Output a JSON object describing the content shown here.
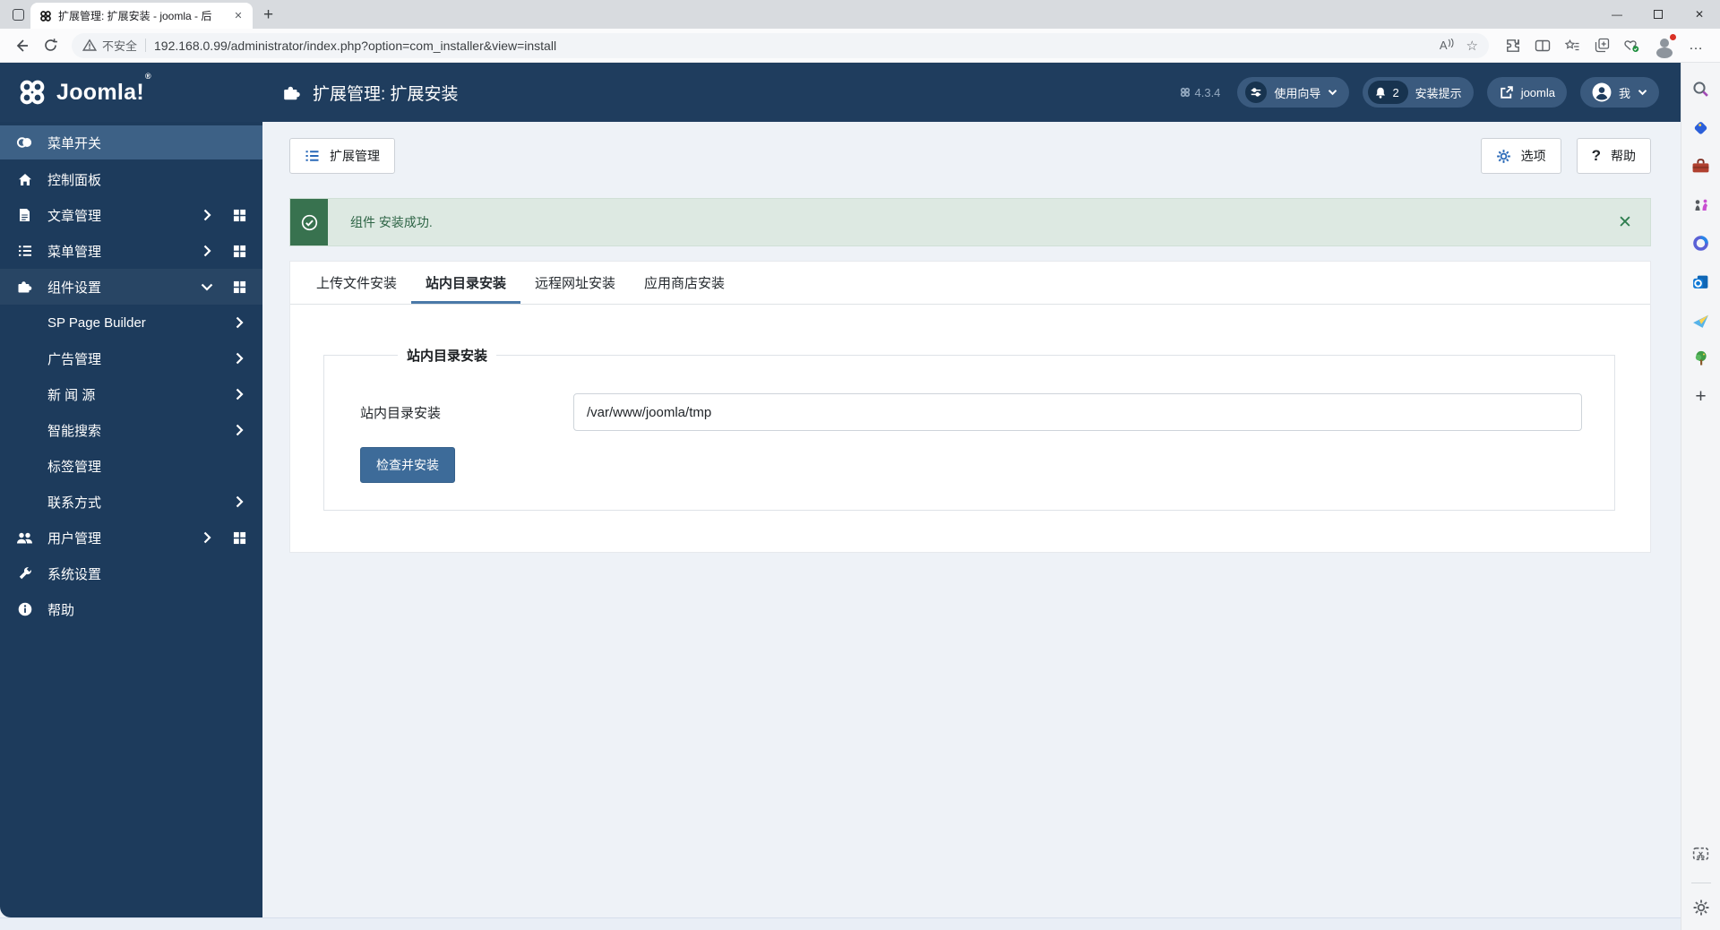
{
  "browser": {
    "tab_title": "扩展管理: 扩展安装 - joomla - 后",
    "new_tab_glyph": "+",
    "security_label": "不安全",
    "url": "192.168.0.99/administrator/index.php?option=com_installer&view=install"
  },
  "glyphs": {
    "close": "✕",
    "minimize": "—",
    "more": "…",
    "read_aloud": "A",
    "star": "☆",
    "plus": "+",
    "question": "?"
  },
  "header": {
    "logo_text": "Joomla!",
    "logo_reg": "®",
    "page_title": "扩展管理: 扩展安装",
    "version": "4.3.4",
    "guide_pill": "使用向导",
    "notice_count": "2",
    "notice_pill": "安装提示",
    "site_pill": "joomla",
    "me_pill": "我"
  },
  "sidebar": {
    "items": [
      {
        "label": "菜单开关",
        "icon": "toggle-icon",
        "active": true
      },
      {
        "label": "控制面板",
        "icon": "home-icon"
      },
      {
        "label": "文章管理",
        "icon": "article-icon",
        "chevron": "right",
        "grid": true
      },
      {
        "label": "菜单管理",
        "icon": "menus-icon",
        "chevron": "right",
        "grid": true
      },
      {
        "label": "组件设置",
        "icon": "components-icon",
        "chevron": "down",
        "grid": true,
        "expanded": true
      },
      {
        "label": "用户管理",
        "icon": "users-icon",
        "chevron": "right",
        "grid": true
      },
      {
        "label": "系统设置",
        "icon": "system-icon"
      },
      {
        "label": "帮助",
        "icon": "help-icon"
      }
    ],
    "sub_items": [
      {
        "label": "SP Page Builder",
        "chevron": "right"
      },
      {
        "label": "广告管理",
        "chevron": "right"
      },
      {
        "label": "新 闻 源",
        "chevron": "right"
      },
      {
        "label": "智能搜索",
        "chevron": "right"
      },
      {
        "label": "标签管理"
      },
      {
        "label": "联系方式",
        "chevron": "right"
      }
    ]
  },
  "toolbar": {
    "manager_button": "扩展管理",
    "options_button": "选项",
    "help_button": "帮助"
  },
  "alert": {
    "message": "组件 安装成功."
  },
  "tabs": [
    {
      "label": "上传文件安装",
      "active": false
    },
    {
      "label": "站内目录安装",
      "active": true
    },
    {
      "label": "远程网址安装",
      "active": false
    },
    {
      "label": "应用商店安装",
      "active": false
    }
  ],
  "form": {
    "legend": "站内目录安装",
    "field_label": "站内目录安装",
    "field_value": "/var/www/joomla/tmp",
    "submit_label": "检查并安装"
  },
  "edge_sidebar_icons": [
    "search",
    "shopping",
    "toolbox",
    "games",
    "microsoft-365",
    "outlook",
    "drop",
    "tree",
    "add",
    "screenshot",
    "settings"
  ],
  "colors": {
    "header_navy": "#1f3d5e",
    "sidebar_navy": "#1d3b5c",
    "active_item": "#3d6186",
    "pill_bg": "#3a5a7e",
    "accent_blue": "#2a69b8",
    "primary_button": "#3d6b99",
    "alert_strip": "#38724f",
    "alert_bg": "#dde9e2",
    "tab_underline": "#4a79a8",
    "page_bg": "#eef2f7"
  }
}
